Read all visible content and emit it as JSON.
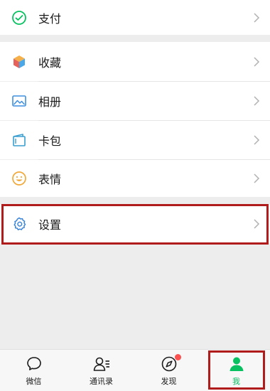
{
  "menu": {
    "pay": {
      "label": "支付",
      "icon": "pay-icon"
    },
    "favorites": {
      "label": "收藏",
      "icon": "favorites-cube-icon"
    },
    "album": {
      "label": "相册",
      "icon": "album-image-icon"
    },
    "cards": {
      "label": "卡包",
      "icon": "card-wallet-icon"
    },
    "stickers": {
      "label": "表情",
      "icon": "smiley-face-icon"
    },
    "settings": {
      "label": "设置",
      "icon": "gear-icon"
    }
  },
  "tabbar": {
    "tabs": [
      {
        "label": "微信",
        "icon": "chat-bubble-icon",
        "active": false
      },
      {
        "label": "通讯录",
        "icon": "contacts-icon",
        "active": false
      },
      {
        "label": "发现",
        "icon": "compass-icon",
        "active": false,
        "badge": true
      },
      {
        "label": "我",
        "icon": "person-icon",
        "active": true
      }
    ]
  },
  "colors": {
    "accent": "#07c160",
    "highlight": "#b01c1c",
    "badge": "#fa5151",
    "background": "#ededed"
  }
}
